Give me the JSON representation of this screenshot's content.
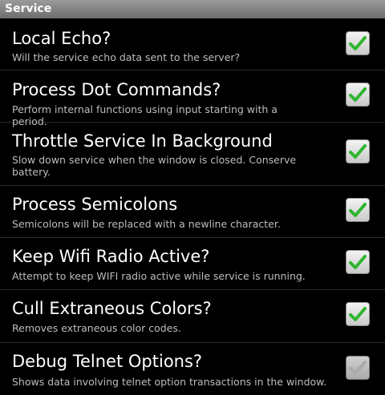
{
  "header": {
    "title": "Service"
  },
  "colors": {
    "check_active": "#2fb52f",
    "check_inactive": "#c8c8c8"
  },
  "settings": [
    {
      "title": "Local Echo?",
      "summary": "Will the service echo data sent to the server?",
      "checked": true,
      "enabled": true
    },
    {
      "title": "Process Dot Commands?",
      "summary": "Perform internal functions using input starting with a period.",
      "checked": true,
      "enabled": true
    },
    {
      "title": "Throttle Service In Background",
      "summary": "Slow down service when the window is closed. Conserve battery.",
      "checked": true,
      "enabled": true
    },
    {
      "title": "Process Semicolons",
      "summary": "Semicolons will be replaced with a newline character.",
      "checked": true,
      "enabled": true
    },
    {
      "title": "Keep Wifi Radio Active?",
      "summary": "Attempt to keep WIFI radio active while service is running.",
      "checked": true,
      "enabled": true
    },
    {
      "title": "Cull Extraneous Colors?",
      "summary": "Removes extraneous color codes.",
      "checked": true,
      "enabled": true
    },
    {
      "title": "Debug Telnet Options?",
      "summary": "Shows data involving telnet option transactions in the window.",
      "checked": true,
      "enabled": false
    }
  ]
}
